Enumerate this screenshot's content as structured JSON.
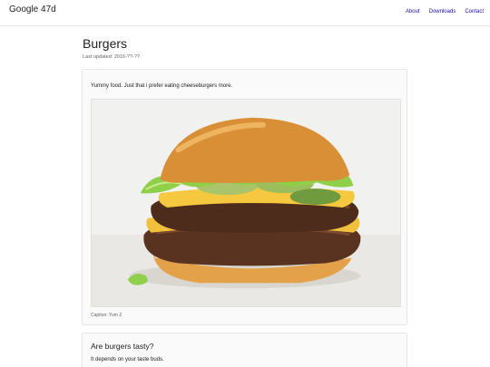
{
  "header": {
    "brand": "Google 47d",
    "nav": [
      {
        "label": "About"
      },
      {
        "label": "Downloads"
      },
      {
        "label": "Contact"
      }
    ]
  },
  "page": {
    "title": "Burgers",
    "last_updated": "Last updated: 2016-??-??"
  },
  "card_main": {
    "intro": "Yummy food. Just that i prefer eating cheeseburgers more.",
    "image_subject": "double cheeseburger with lettuce and pickles",
    "caption": "Caption: Yum 2"
  },
  "card_second": {
    "heading": "Are burgers tasty?",
    "body": "It depends on your taste buds."
  }
}
